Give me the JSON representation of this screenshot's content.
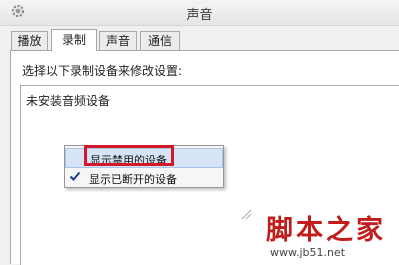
{
  "window": {
    "title": "声音"
  },
  "tabs": [
    {
      "label": "播放"
    },
    {
      "label": "录制"
    },
    {
      "label": "声音"
    },
    {
      "label": "通信"
    }
  ],
  "panel": {
    "instruction": "选择以下录制设备来修改设置:",
    "empty_message": "未安装音频设备"
  },
  "context_menu": {
    "items": [
      {
        "label": "显示禁用的设备",
        "checked": false,
        "highlighted": true
      },
      {
        "label": "显示已断开的设备",
        "checked": true,
        "highlighted": false
      }
    ]
  },
  "watermark": {
    "logo_text": "脚本之家",
    "url": "www.jb51.net"
  },
  "colors": {
    "highlight_box": "#d4182a",
    "menu_highlight": "#d5e5f7",
    "watermark_red": "#c11d1d"
  }
}
